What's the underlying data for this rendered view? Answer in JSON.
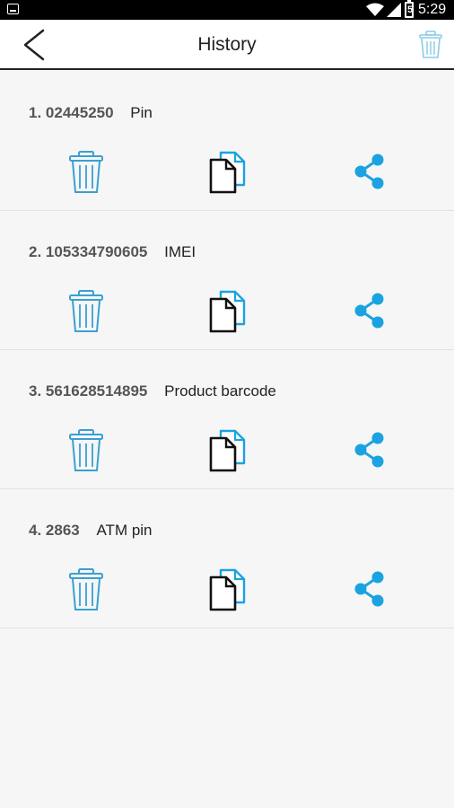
{
  "status_bar": {
    "time": "5:29",
    "battery_level": "5"
  },
  "app_bar": {
    "title": "History"
  },
  "colors": {
    "accent": "#1aa3e0",
    "trash": "#3aa0d2"
  },
  "items": [
    {
      "index": "1.",
      "value": "02445250",
      "label": "Pin"
    },
    {
      "index": "2.",
      "value": "105334790605",
      "label": "IMEI"
    },
    {
      "index": "3.",
      "value": "561628514895",
      "label": "Product barcode"
    },
    {
      "index": "4.",
      "value": "2863",
      "label": "ATM pin"
    }
  ],
  "icons": [
    "back-arrow-icon",
    "trash-icon",
    "copy-icon",
    "share-icon"
  ]
}
